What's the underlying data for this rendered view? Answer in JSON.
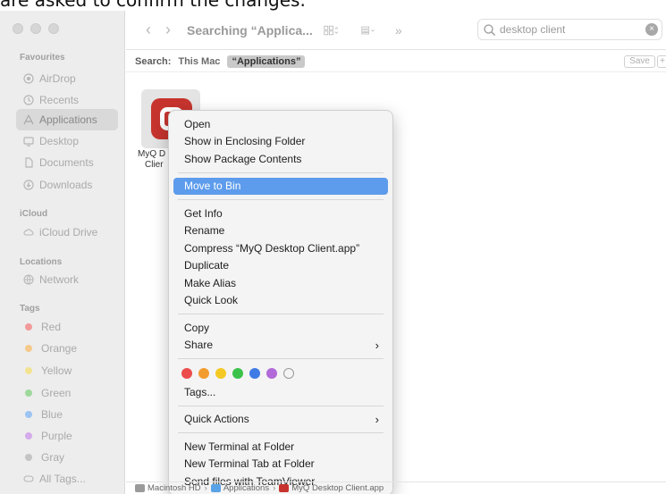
{
  "caption": "are asked to confirm the changes.",
  "sidebar": {
    "sections": {
      "favourites": "Favourites",
      "icloud": "iCloud",
      "locations": "Locations",
      "tags": "Tags"
    },
    "favourites": [
      {
        "label": "AirDrop",
        "icon": "airdrop-icon"
      },
      {
        "label": "Recents",
        "icon": "clock-icon"
      },
      {
        "label": "Applications",
        "icon": "applications-icon"
      },
      {
        "label": "Desktop",
        "icon": "desktop-icon"
      },
      {
        "label": "Documents",
        "icon": "document-icon"
      },
      {
        "label": "Downloads",
        "icon": "download-icon"
      }
    ],
    "icloud": [
      {
        "label": "iCloud Drive",
        "icon": "cloud-icon"
      }
    ],
    "locations": [
      {
        "label": "Network",
        "icon": "network-icon"
      }
    ],
    "tags": [
      {
        "label": "Red",
        "color": "#f29a9a"
      },
      {
        "label": "Orange",
        "color": "#f5c98a"
      },
      {
        "label": "Yellow",
        "color": "#f3e391"
      },
      {
        "label": "Green",
        "color": "#9ed99b"
      },
      {
        "label": "Blue",
        "color": "#9cc4f3"
      },
      {
        "label": "Purple",
        "color": "#d5aaea"
      },
      {
        "label": "Gray",
        "color": "#c4c4c4"
      }
    ],
    "all_tags": "All Tags..."
  },
  "toolbar": {
    "title": "Searching “Applica...",
    "search_value": "desktop client"
  },
  "scope": {
    "label": "Search:",
    "this_mac": "This Mac",
    "selected": "“Applications”",
    "save": "Save",
    "plus": "+"
  },
  "file": {
    "name_line1": "MyQ D",
    "name_line2": "Clier"
  },
  "menu": {
    "group1": [
      "Open",
      "Show in Enclosing Folder",
      "Show Package Contents"
    ],
    "move_to_bin": "Move to Bin",
    "group3": [
      "Get Info",
      "Rename",
      "Compress “MyQ Desktop Client.app”",
      "Duplicate",
      "Make Alias",
      "Quick Look"
    ],
    "copy": "Copy",
    "share": "Share",
    "tag_colors": [
      "#ec4c4c",
      "#f39c2e",
      "#f5c924",
      "#3cc24a",
      "#3f7be4",
      "#b16ad8"
    ],
    "tags": "Tags...",
    "quick_actions": "Quick Actions",
    "group_last": [
      "New Terminal at Folder",
      "New Terminal Tab at Folder",
      "Send files with TeamViewer"
    ],
    "highlight_color": "#5d9cec"
  },
  "pathbar": [
    "Macintosh HD",
    "Applications",
    "MyQ Desktop Client.app"
  ]
}
